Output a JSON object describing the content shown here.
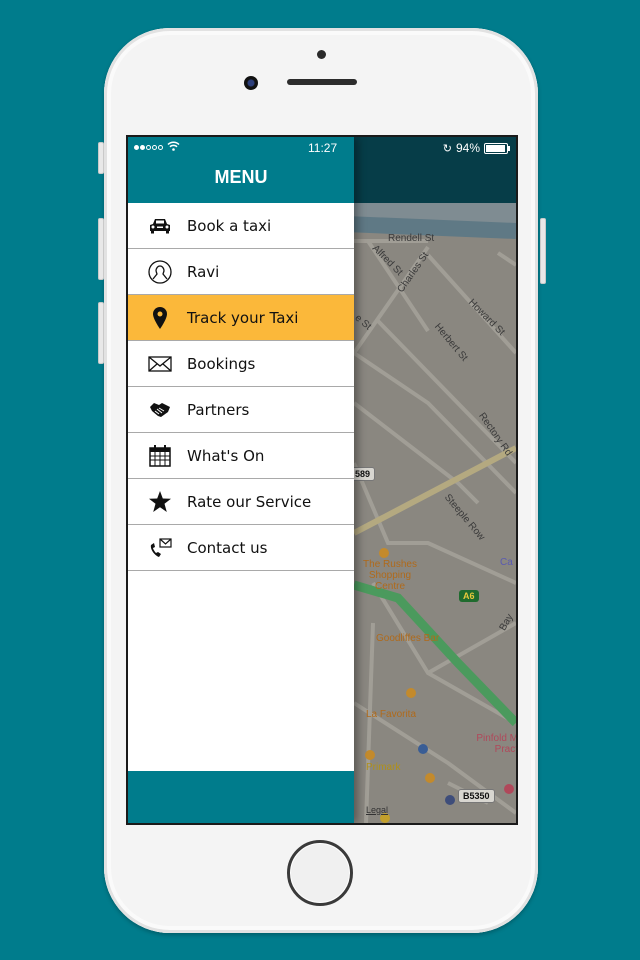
{
  "status_bar": {
    "time": "11:27",
    "battery_percent": "94%",
    "battery_level": 0.94,
    "signal_bars_filled": 2,
    "signal_bars_total": 5
  },
  "drawer": {
    "title": "MENU",
    "active_item": "Track your Taxi",
    "items": [
      {
        "label": "Book a taxi",
        "icon": "car-icon"
      },
      {
        "label": "Ravi",
        "icon": "user-icon"
      },
      {
        "label": "Track your Taxi",
        "icon": "map-pin-icon"
      },
      {
        "label": "Bookings",
        "icon": "envelope-icon"
      },
      {
        "label": "Partners",
        "icon": "handshake-icon"
      },
      {
        "label": "What's On",
        "icon": "calendar-icon"
      },
      {
        "label": "Rate our Service",
        "icon": "star-icon"
      },
      {
        "label": "Contact us",
        "icon": "phone-mail-icon"
      }
    ]
  },
  "map": {
    "streets": [
      "Rendell St",
      "Alfred St",
      "Charles St",
      "Howard St",
      "Herbert St",
      "Rectory Rd",
      "Steeple Row",
      "e St"
    ],
    "road_shields": [
      "589",
      "A6",
      "B5350"
    ],
    "pois": [
      "The Rushes Shopping Centre",
      "Goodliffes Bar",
      "La Favorita",
      "Primark",
      "Pinfold M Pract"
    ],
    "partial_labels": [
      "Ca",
      "Bay"
    ],
    "legal": "Legal"
  },
  "colors": {
    "brand_teal": "#007c8c",
    "map_header": "#063d48",
    "active_item": "#fbb83a"
  }
}
